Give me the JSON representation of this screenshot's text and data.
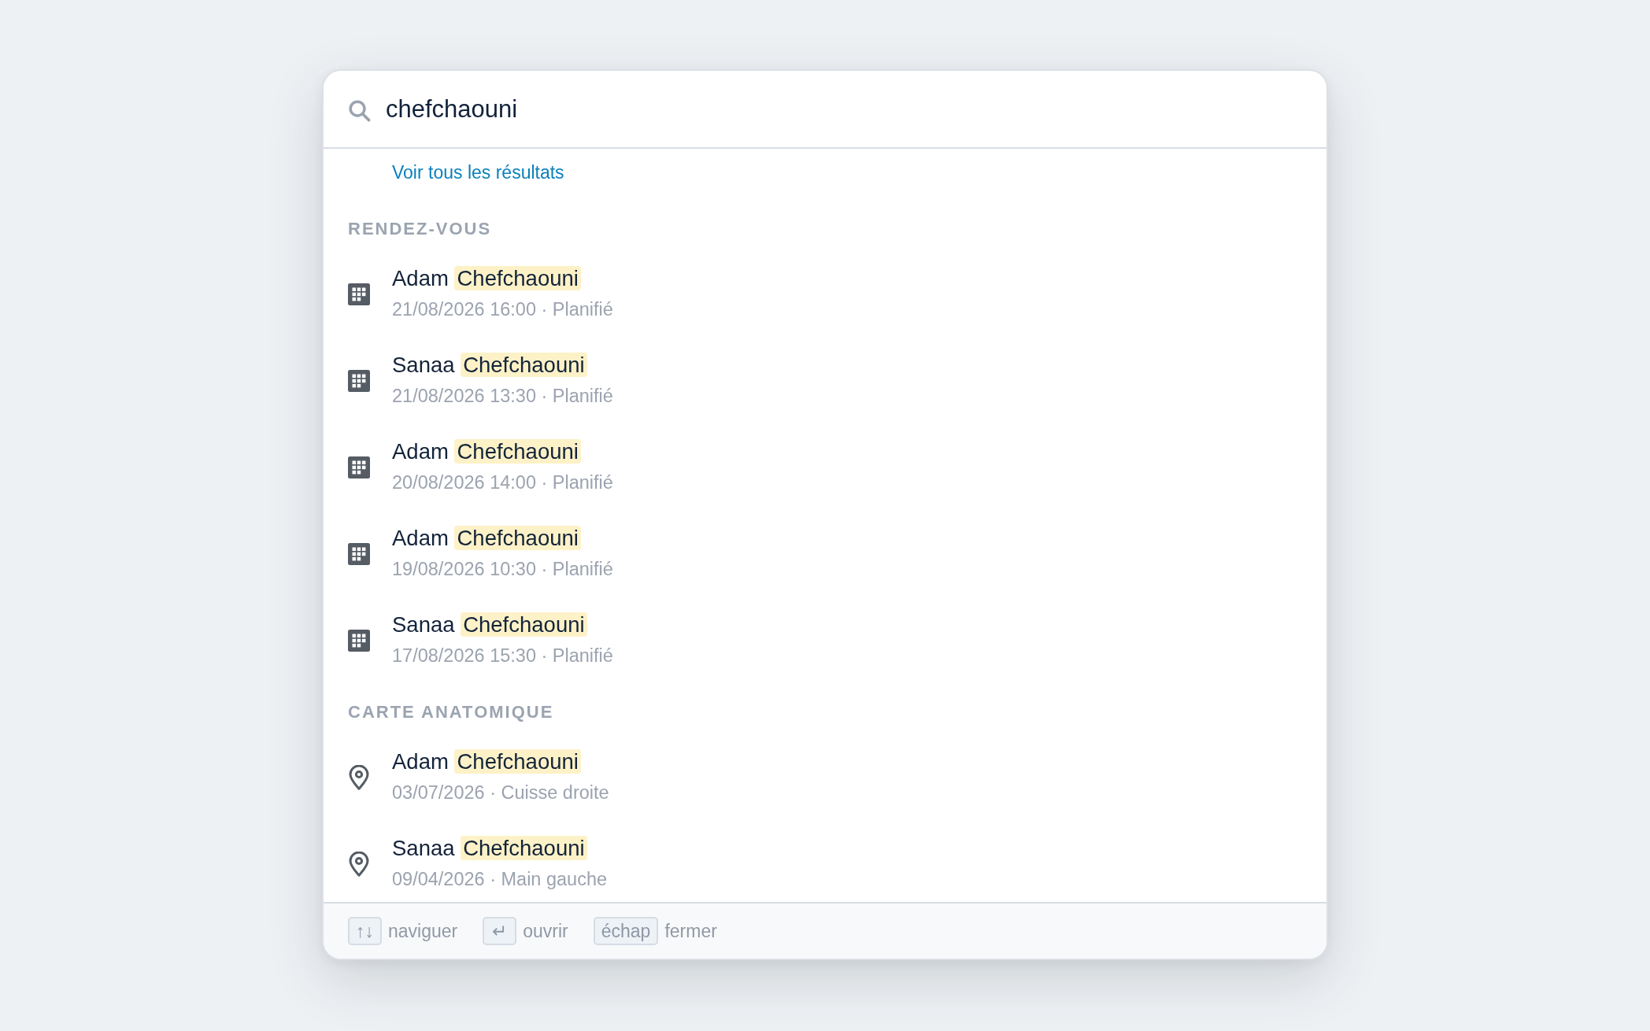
{
  "search": {
    "value": "chefchaouni"
  },
  "view_all_link": "Voir tous les résultats",
  "sections": [
    {
      "kind": "appointments",
      "title": "RENDEZ-VOUS",
      "items": [
        {
          "name": [
            {
              "text": "Adam",
              "highlighted": false
            },
            {
              "text": "Chefchaouni",
              "highlighted": true
            }
          ],
          "meta": "21/08/2026 16:00 · Planifié"
        },
        {
          "name": [
            {
              "text": "Sanaa",
              "highlighted": false
            },
            {
              "text": "Chefchaouni",
              "highlighted": true
            }
          ],
          "meta": "21/08/2026 13:30 · Planifié"
        },
        {
          "name": [
            {
              "text": "Adam",
              "highlighted": false
            },
            {
              "text": "Chefchaouni",
              "highlighted": true
            }
          ],
          "meta": "20/08/2026 14:00 · Planifié"
        },
        {
          "name": [
            {
              "text": "Adam",
              "highlighted": false
            },
            {
              "text": "Chefchaouni",
              "highlighted": true
            }
          ],
          "meta": "19/08/2026 10:30 · Planifié"
        },
        {
          "name": [
            {
              "text": "Sanaa",
              "highlighted": false
            },
            {
              "text": "Chefchaouni",
              "highlighted": true
            }
          ],
          "meta": "17/08/2026 15:30 · Planifié"
        }
      ]
    },
    {
      "kind": "anatomy_map",
      "title": "CARTE ANATOMIQUE",
      "items": [
        {
          "name": [
            {
              "text": "Adam",
              "highlighted": false
            },
            {
              "text": "Chefchaouni",
              "highlighted": true
            }
          ],
          "meta": "03/07/2026 · Cuisse droite"
        },
        {
          "name": [
            {
              "text": "Sanaa",
              "highlighted": false
            },
            {
              "text": "Chefchaouni",
              "highlighted": true
            }
          ],
          "meta": "09/04/2026 · Main gauche"
        }
      ]
    }
  ],
  "footer": {
    "hints": [
      {
        "key": "↑↓",
        "label": "naviguer"
      },
      {
        "key": "↵",
        "label": "ouvrir"
      },
      {
        "key": "échap",
        "label": "fermer"
      }
    ]
  }
}
